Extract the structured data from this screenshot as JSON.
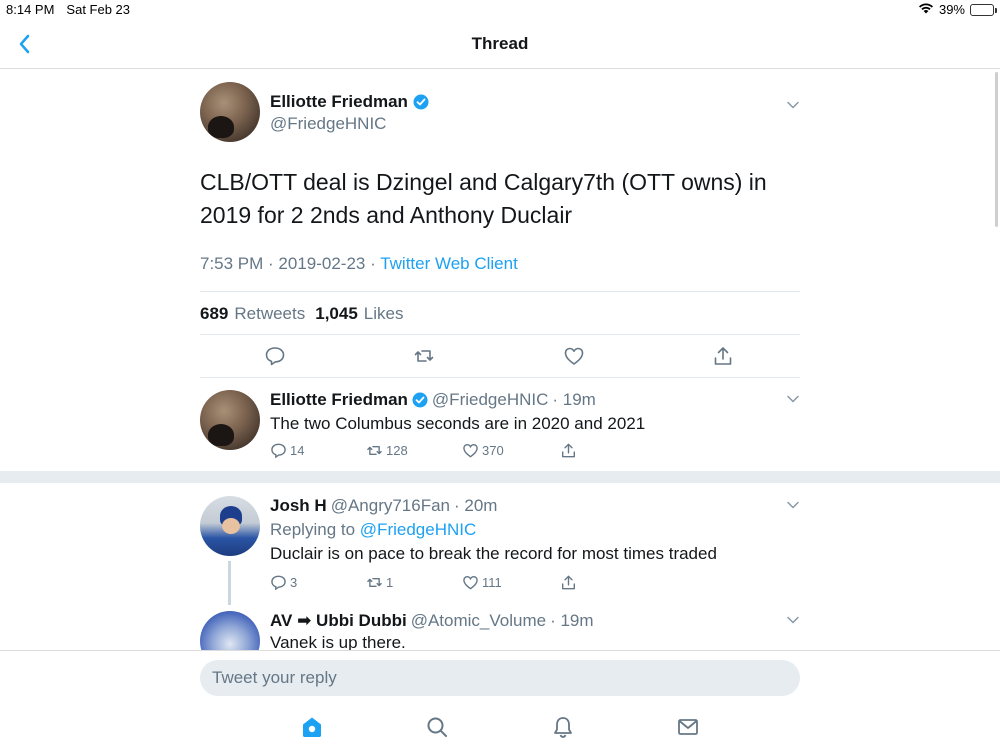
{
  "status_bar": {
    "time": "8:14 PM",
    "date": "Sat Feb 23",
    "battery": "39%",
    "battery_level": 0.39
  },
  "nav": {
    "title": "Thread"
  },
  "main_tweet": {
    "name": "Elliotte Friedman",
    "handle": "@FriedgeHNIC",
    "text": "CLB/OTT deal is Dzingel and Calgary7th (OTT owns) in 2019 for 2 2nds and Anthony Duclair",
    "time": "7:53 PM · 2019-02-23 · ",
    "client": "Twitter Web Client",
    "retweets_count": "689",
    "retweets_label": "Retweets",
    "likes_count": "1,045",
    "likes_label": "Likes"
  },
  "replies": [
    {
      "name": "Elliotte Friedman",
      "handle": "@FriedgeHNIC",
      "age": "· 19m",
      "text": "The two Columbus seconds are in 2020 and 2021",
      "reply_count": "14",
      "retweet_count": "128",
      "like_count": "370"
    },
    {
      "name": "Josh H",
      "handle": "@Angry716Fan",
      "age": "· 20m",
      "replying_prefix": "Replying to",
      "replying_to": "@FriedgeHNIC",
      "text": "Duclair is on pace to break the record for most times traded",
      "reply_count": "3",
      "retweet_count": "1",
      "like_count": "111"
    },
    {
      "name": "AV ➡ Ubbi Dubbi",
      "handle": "@Atomic_Volume",
      "age": "· 19m",
      "text": "Vanek is up there."
    }
  ],
  "compose": {
    "placeholder": "Tweet your reply"
  },
  "colors": {
    "accent": "#1da1f2",
    "muted": "#657786",
    "text": "#14171a",
    "battery": "#4cd964"
  },
  "icons": {
    "back": "chevron-left-icon",
    "verified": "verified-badge-icon",
    "caret": "chevron-down-icon",
    "reply": "reply-icon",
    "retweet": "retweet-icon",
    "like": "heart-icon",
    "share": "share-icon",
    "home": "home-icon",
    "search": "search-icon",
    "notifications": "bell-icon",
    "messages": "mail-icon"
  }
}
